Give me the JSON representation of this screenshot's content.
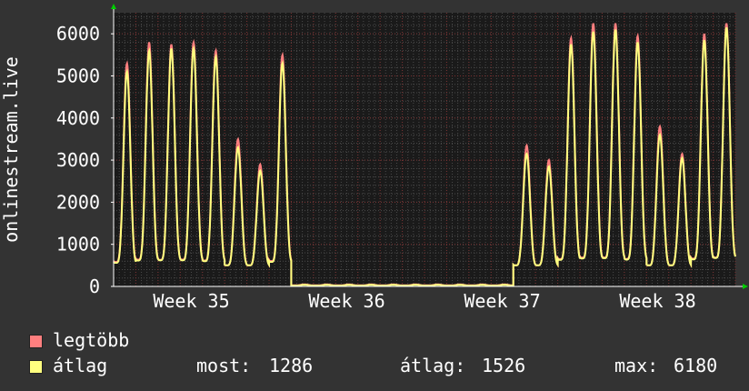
{
  "chart_data": {
    "type": "line",
    "ylabel": "onlinestream.live",
    "xlabel": "",
    "title": "",
    "ylim": [
      0,
      6500
    ],
    "yticks": [
      0,
      1000,
      2000,
      3000,
      4000,
      5000,
      6000
    ],
    "xlim": [
      0,
      28
    ],
    "xticks": [
      {
        "value": 3.5,
        "label": "Week 35"
      },
      {
        "value": 10.5,
        "label": "Week 36"
      },
      {
        "value": 17.5,
        "label": "Week 37"
      },
      {
        "value": 24.5,
        "label": "Week 38"
      }
    ],
    "grid": true,
    "legend_position": "bottom-left",
    "daily_peaks_max": [
      5300,
      5800,
      5750,
      5800,
      5600,
      3500,
      2900,
      5500,
      50,
      50,
      50,
      50,
      50,
      50,
      50,
      50,
      50,
      50,
      3350,
      3000,
      5900,
      6250,
      6250,
      5950,
      3800,
      3150,
      6000,
      6250
    ],
    "daily_peaks_avg": [
      5100,
      5600,
      5650,
      5650,
      5450,
      3300,
      2750,
      5300,
      40,
      40,
      40,
      40,
      40,
      40,
      40,
      40,
      40,
      40,
      3150,
      2850,
      5750,
      6050,
      6100,
      5800,
      3600,
      3050,
      5850,
      6150
    ],
    "series": [
      {
        "name": "legtöbb",
        "color": "#ff7f7f"
      },
      {
        "name": "átlag",
        "color": "#ffff7f"
      }
    ],
    "stats": {
      "now_label": "most:",
      "now": "1286",
      "avg_label": "átlag:",
      "avg": "1526",
      "max_label": "max:",
      "max": "6180"
    }
  },
  "colors": {
    "background": "#333333",
    "plot_bg": "#1a1a1a",
    "grid": "#4a4a4a",
    "grid_major": "#7a3030",
    "axis": "#ffffff",
    "arrow": "#00cc00"
  }
}
